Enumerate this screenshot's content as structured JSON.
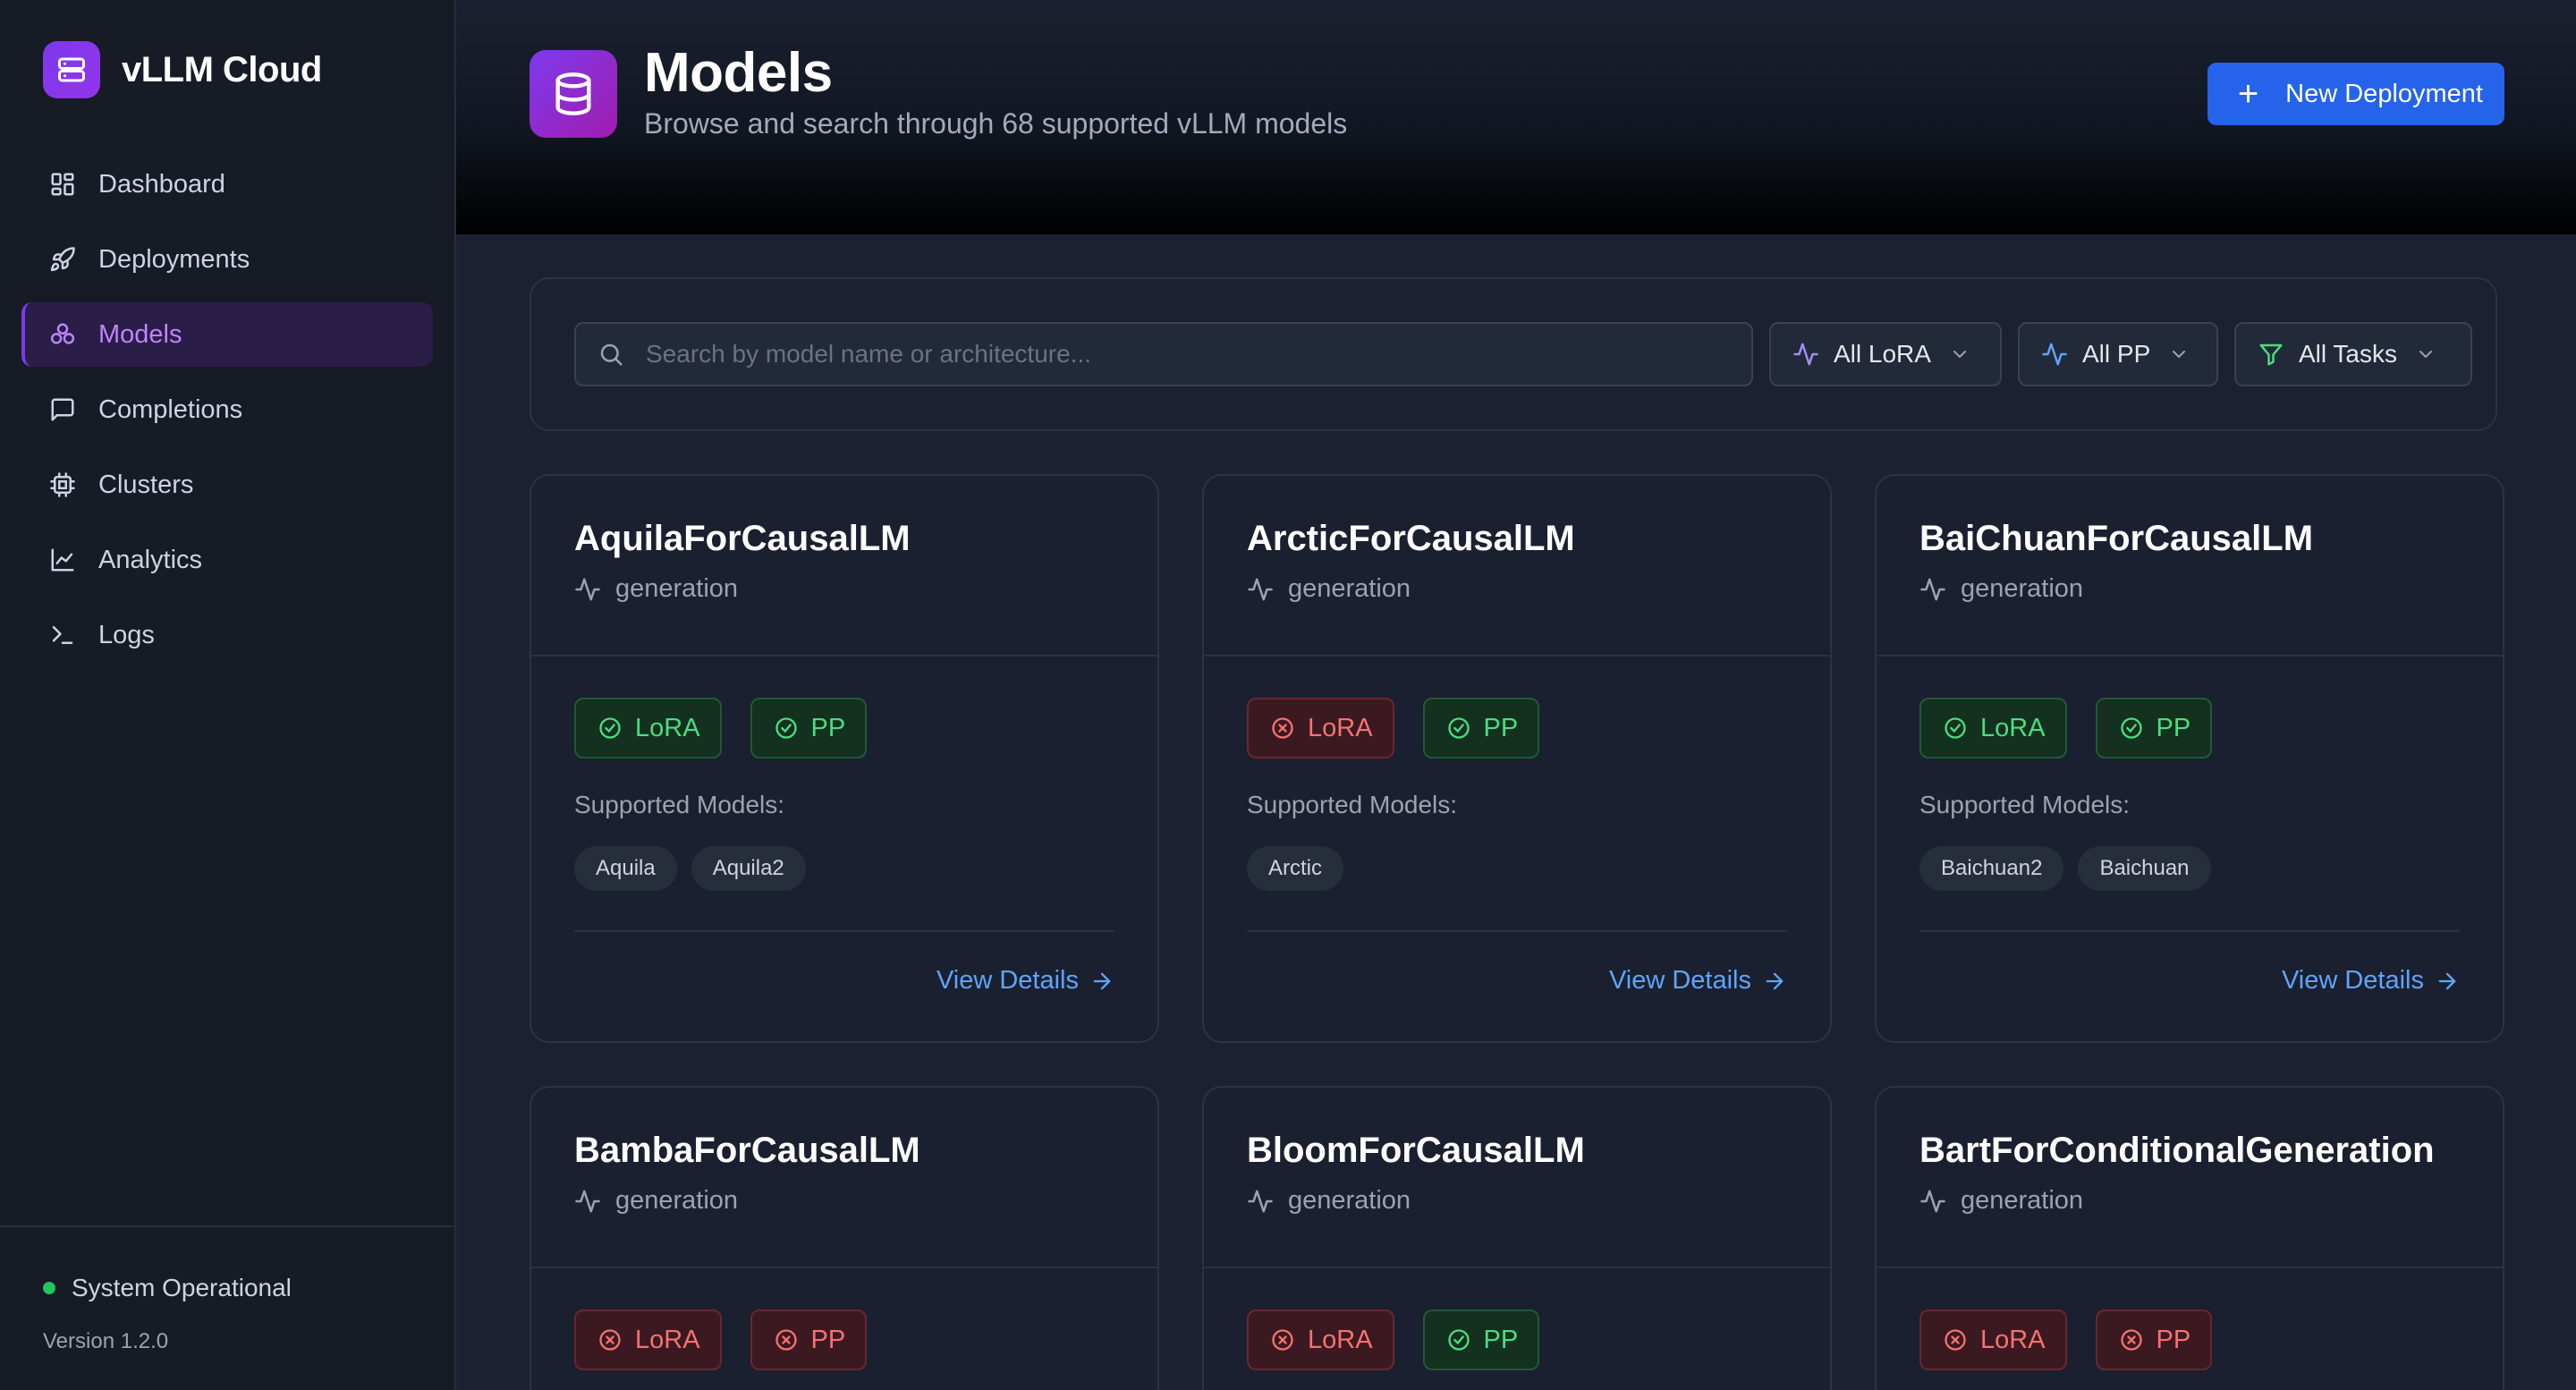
{
  "app": {
    "name": "vLLM Cloud",
    "status_text": "System Operational",
    "version": "Version 1.2.0"
  },
  "sidebar": {
    "items": [
      {
        "label": "Dashboard",
        "icon": "dashboard-icon"
      },
      {
        "label": "Deployments",
        "icon": "rocket-icon"
      },
      {
        "label": "Models",
        "icon": "models-icon",
        "active": true
      },
      {
        "label": "Completions",
        "icon": "chat-icon"
      },
      {
        "label": "Clusters",
        "icon": "cpu-icon"
      },
      {
        "label": "Analytics",
        "icon": "chart-icon"
      },
      {
        "label": "Logs",
        "icon": "terminal-icon"
      }
    ]
  },
  "header": {
    "title": "Models",
    "subtitle": "Browse and search through 68 supported vLLM models",
    "new_button": "New Deployment"
  },
  "filters": {
    "search_placeholder": "Search by model name or architecture...",
    "lora": "All LoRA",
    "pp": "All PP",
    "tasks": "All Tasks"
  },
  "labels": {
    "supported_models": "Supported Models:",
    "view_details": "View Details",
    "lora": "LoRA",
    "pp": "PP"
  },
  "cards": [
    {
      "name": "AquilaForCausalLM",
      "task": "generation",
      "lora": true,
      "pp": true,
      "models": [
        "Aquila",
        "Aquila2"
      ]
    },
    {
      "name": "ArcticForCausalLM",
      "task": "generation",
      "lora": false,
      "pp": true,
      "models": [
        "Arctic"
      ]
    },
    {
      "name": "BaiChuanForCausalLM",
      "task": "generation",
      "lora": true,
      "pp": true,
      "models": [
        "Baichuan2",
        "Baichuan"
      ]
    },
    {
      "name": "BambaForCausalLM",
      "task": "generation",
      "lora": false,
      "pp": false,
      "models": []
    },
    {
      "name": "BloomForCausalLM",
      "task": "generation",
      "lora": false,
      "pp": true,
      "models": []
    },
    {
      "name": "BartForConditionalGeneration",
      "task": "generation",
      "lora": false,
      "pp": false,
      "models": []
    }
  ],
  "colors": {
    "accent": "#7c3aed",
    "primary_button": "#2563eb",
    "supported": "#4ade80",
    "unsupported": "#f87171",
    "link": "#60a5fa",
    "status_ok": "#22c55e"
  }
}
